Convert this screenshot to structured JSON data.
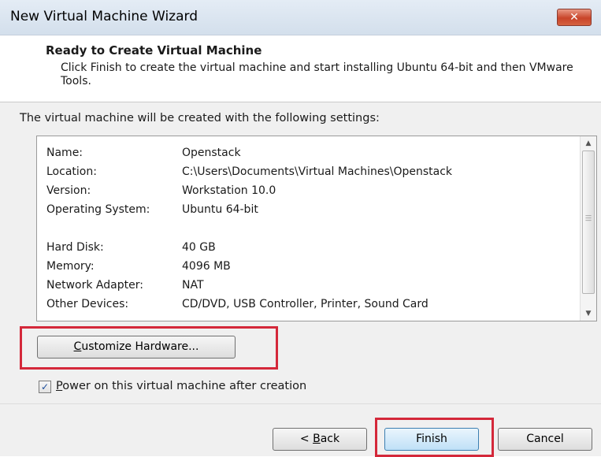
{
  "window": {
    "title": "New Virtual Machine Wizard",
    "close_glyph": "✕"
  },
  "header": {
    "title": "Ready to Create Virtual Machine",
    "description": "Click Finish to create the virtual machine and start installing Ubuntu 64-bit and then VMware Tools."
  },
  "body": {
    "intro": "The virtual machine will be created with the following settings:",
    "settings": [
      {
        "key": "Name:",
        "value": "Openstack"
      },
      {
        "key": "Location:",
        "value": "C:\\Users\\Documents\\Virtual Machines\\Openstack"
      },
      {
        "key": "Version:",
        "value": "Workstation 10.0"
      },
      {
        "key": "Operating System:",
        "value": "Ubuntu 64-bit"
      },
      {
        "key": "",
        "value": ""
      },
      {
        "key": "Hard Disk:",
        "value": "40 GB"
      },
      {
        "key": "Memory:",
        "value": "4096 MB"
      },
      {
        "key": "Network Adapter:",
        "value": "NAT"
      },
      {
        "key": "Other Devices:",
        "value": "CD/DVD, USB Controller, Printer, Sound Card"
      }
    ],
    "customize_first": "C",
    "customize_rest": "ustomize Hardware...",
    "power_on_first": "P",
    "power_on_rest": "ower on this virtual machine after creation",
    "power_on_checked": true
  },
  "footer": {
    "back_prefix": "< ",
    "back_underlined": "B",
    "back_rest": "ack",
    "finish_label": "Finish",
    "cancel_label": "Cancel"
  },
  "colors": {
    "highlight": "#d4283a",
    "dialog_bg": "#f0f0f0"
  }
}
